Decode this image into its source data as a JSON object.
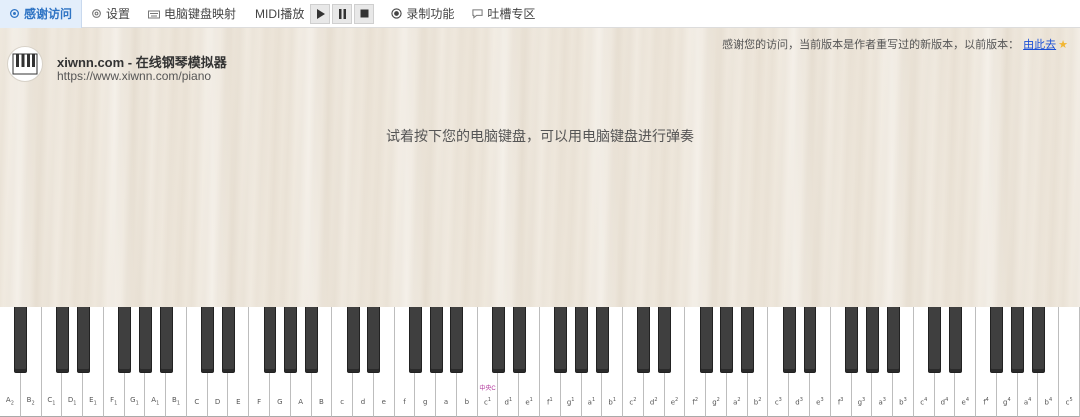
{
  "toolbar": {
    "items": [
      {
        "label": "感谢访问",
        "icon": "gear-badge-icon",
        "active": true
      },
      {
        "label": "设置",
        "icon": "settings-icon"
      },
      {
        "label": "电脑键盘映射",
        "icon": "keyboard-icon"
      }
    ],
    "midi": {
      "label": "MIDI播放",
      "buttons": [
        "play-icon",
        "pause-icon",
        "stop-icon"
      ]
    },
    "record": {
      "label": "录制功能",
      "icon": "record-icon"
    },
    "chat": {
      "label": "吐槽专区",
      "icon": "chat-bubble-icon"
    }
  },
  "header": {
    "title": "xiwnn.com - 在线钢琴模拟器",
    "url": "https://www.xiwnn.com/piano",
    "notice_text": "感谢您的访问，当前版本是作者重写过的新版本，以前版本：",
    "notice_link": "由此去"
  },
  "hint": "试着按下您的电脑键盘，可以用电脑键盘进行弹奏",
  "keyboard": {
    "middle_c_label": "中央C",
    "white_keys": [
      {
        "n": "A",
        "m": "2",
        "t": "sub"
      },
      {
        "n": "B",
        "m": "2",
        "t": "sub"
      },
      {
        "n": "C",
        "m": "1",
        "t": "sub"
      },
      {
        "n": "D",
        "m": "1",
        "t": "sub"
      },
      {
        "n": "E",
        "m": "1",
        "t": "sub"
      },
      {
        "n": "F",
        "m": "1",
        "t": "sub"
      },
      {
        "n": "G",
        "m": "1",
        "t": "sub"
      },
      {
        "n": "A",
        "m": "1",
        "t": "sub"
      },
      {
        "n": "B",
        "m": "1",
        "t": "sub"
      },
      {
        "n": "C",
        "m": "",
        "t": ""
      },
      {
        "n": "D",
        "m": "",
        "t": ""
      },
      {
        "n": "E",
        "m": "",
        "t": ""
      },
      {
        "n": "F",
        "m": "",
        "t": ""
      },
      {
        "n": "G",
        "m": "",
        "t": ""
      },
      {
        "n": "A",
        "m": "",
        "t": ""
      },
      {
        "n": "B",
        "m": "",
        "t": ""
      },
      {
        "n": "c",
        "m": "",
        "t": ""
      },
      {
        "n": "d",
        "m": "",
        "t": ""
      },
      {
        "n": "e",
        "m": "",
        "t": ""
      },
      {
        "n": "f",
        "m": "",
        "t": ""
      },
      {
        "n": "g",
        "m": "",
        "t": ""
      },
      {
        "n": "a",
        "m": "",
        "t": ""
      },
      {
        "n": "b",
        "m": "",
        "t": ""
      },
      {
        "n": "c",
        "m": "1",
        "t": "sup"
      },
      {
        "n": "d",
        "m": "1",
        "t": "sup"
      },
      {
        "n": "e",
        "m": "1",
        "t": "sup"
      },
      {
        "n": "f",
        "m": "1",
        "t": "sup"
      },
      {
        "n": "g",
        "m": "1",
        "t": "sup"
      },
      {
        "n": "a",
        "m": "1",
        "t": "sup"
      },
      {
        "n": "b",
        "m": "1",
        "t": "sup"
      },
      {
        "n": "c",
        "m": "2",
        "t": "sup"
      },
      {
        "n": "d",
        "m": "2",
        "t": "sup"
      },
      {
        "n": "e",
        "m": "2",
        "t": "sup"
      },
      {
        "n": "f",
        "m": "2",
        "t": "sup"
      },
      {
        "n": "g",
        "m": "2",
        "t": "sup"
      },
      {
        "n": "a",
        "m": "2",
        "t": "sup"
      },
      {
        "n": "b",
        "m": "2",
        "t": "sup"
      },
      {
        "n": "c",
        "m": "3",
        "t": "sup"
      },
      {
        "n": "d",
        "m": "3",
        "t": "sup"
      },
      {
        "n": "e",
        "m": "3",
        "t": "sup"
      },
      {
        "n": "f",
        "m": "3",
        "t": "sup"
      },
      {
        "n": "g",
        "m": "3",
        "t": "sup"
      },
      {
        "n": "a",
        "m": "3",
        "t": "sup"
      },
      {
        "n": "b",
        "m": "3",
        "t": "sup"
      },
      {
        "n": "c",
        "m": "4",
        "t": "sup"
      },
      {
        "n": "d",
        "m": "4",
        "t": "sup"
      },
      {
        "n": "e",
        "m": "4",
        "t": "sup"
      },
      {
        "n": "f",
        "m": "4",
        "t": "sup"
      },
      {
        "n": "g",
        "m": "4",
        "t": "sup"
      },
      {
        "n": "a",
        "m": "4",
        "t": "sup"
      },
      {
        "n": "b",
        "m": "4",
        "t": "sup"
      },
      {
        "n": "c",
        "m": "5",
        "t": "sup"
      }
    ]
  },
  "colors": {
    "accent": "#2f74c4",
    "link": "#1a4fd6",
    "middle_c": "#b0339a",
    "black_key": "#3f3f3f"
  }
}
